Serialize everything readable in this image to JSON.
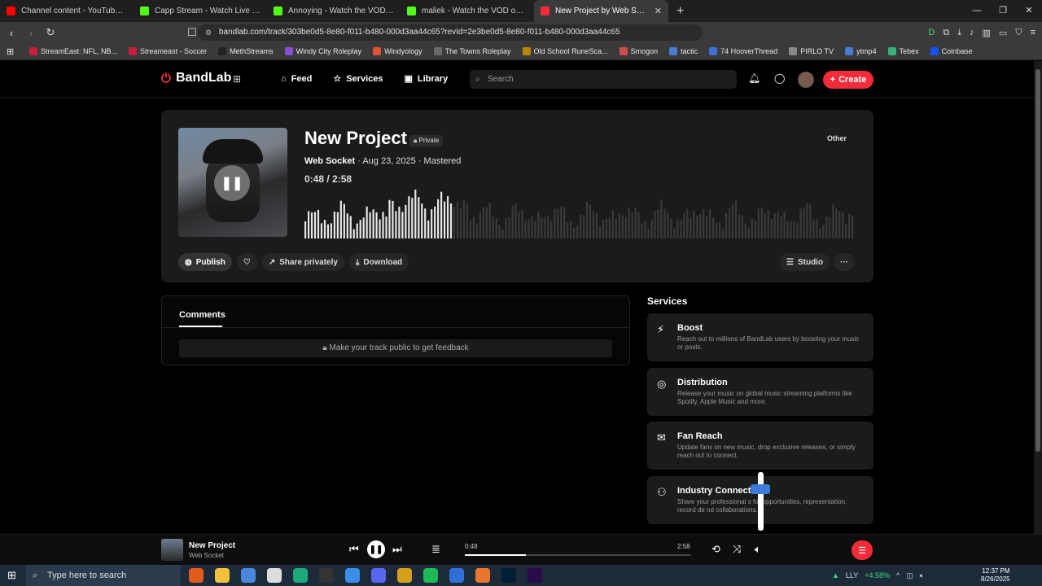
{
  "browser": {
    "tabs": [
      {
        "title": "Channel content - YouTube Studio",
        "color": "#ff0000",
        "active": false
      },
      {
        "title": "Capp Stream - Watch Live on Kick",
        "color": "#53fc18",
        "active": false
      },
      {
        "title": "Annoying - Watch the VOD on Kick",
        "color": "#53fc18",
        "active": false
      },
      {
        "title": "maliek - Watch the VOD on Kick",
        "color": "#53fc18",
        "active": false
      },
      {
        "title": "New Project by Web Socket |",
        "color": "#f22b3b",
        "active": true
      }
    ],
    "new_tab": "+",
    "url": "bandlab.com/track/303be0d5-8e80-f011-b480-000d3aa44c65?revId=2e3be0d5-8e80-f011-b480-000d3aa44c65",
    "bookmarks": [
      {
        "label": "StreamEast: NFL, NB...",
        "color": "#c4203b"
      },
      {
        "label": "Streameast - Soccer",
        "color": "#c4203b"
      },
      {
        "label": "MethStreams",
        "color": "#222222"
      },
      {
        "label": "Windy City Roleplay",
        "color": "#8a4fd1"
      },
      {
        "label": "Windyology",
        "color": "#e0523a"
      },
      {
        "label": "The Towns Roleplay",
        "color": "#6a6a6a"
      },
      {
        "label": "Old School RuneSca...",
        "color": "#b8860b"
      },
      {
        "label": "Smogon",
        "color": "#d14b4b"
      },
      {
        "label": "tactic",
        "color": "#4a7bd1"
      },
      {
        "label": "74 HooverThread",
        "color": "#3d6fd6"
      },
      {
        "label": "PIRLO TV",
        "color": "#888888"
      },
      {
        "label": "ytmp4",
        "color": "#4a7bd1"
      },
      {
        "label": "Tebex",
        "color": "#38b27a"
      },
      {
        "label": "Coinbase",
        "color": "#1652f0"
      }
    ]
  },
  "nav": {
    "logo": "BandLab",
    "links": [
      {
        "icon": "home-icon",
        "label": "Feed"
      },
      {
        "icon": "star-icon",
        "label": "Services"
      },
      {
        "icon": "library-icon",
        "label": "Library"
      }
    ],
    "search_placeholder": "Search",
    "create": "Create"
  },
  "track": {
    "title": "New Project",
    "visibility": "Private",
    "artist": "Web Socket",
    "date_status": " · Aug 23, 2025 · Mastered",
    "time": "0:48 / 2:58",
    "genre": "Other",
    "progress": 0.27,
    "actions": {
      "publish": "Publish",
      "share": "Share privately",
      "download": "Download",
      "studio": "Studio"
    }
  },
  "comments": {
    "title": "Comments",
    "notice": "Make your track public to get feedback"
  },
  "services": {
    "title": "Services",
    "items": [
      {
        "icon": "bolt-icon",
        "title": "Boost",
        "desc": "Reach out to millions of BandLab users by boosting your music or posts."
      },
      {
        "icon": "distribution-icon",
        "title": "Distribution",
        "desc": "Release your music on global music streaming platforms like Spotify, Apple Music and more."
      },
      {
        "icon": "mail-icon",
        "title": "Fan Reach",
        "desc": "Update fans on new music, drop exclusive releases, or simply reach out to connect."
      },
      {
        "icon": "people-icon",
        "title": "Industry Connect",
        "desc": "Share your professional s for opportunities, representation, record de nd collaborations."
      }
    ]
  },
  "player": {
    "title": "New Project",
    "artist": "Web Socket",
    "current": "0:48",
    "duration": "2:58",
    "progress": 0.27
  },
  "taskbar": {
    "search_placeholder": "Type here to search",
    "ticker": "LLY",
    "change": "+4.58%",
    "time": "12:37 PM",
    "date": "8/26/2025"
  },
  "colors": {
    "accent": "#f22b3b"
  }
}
